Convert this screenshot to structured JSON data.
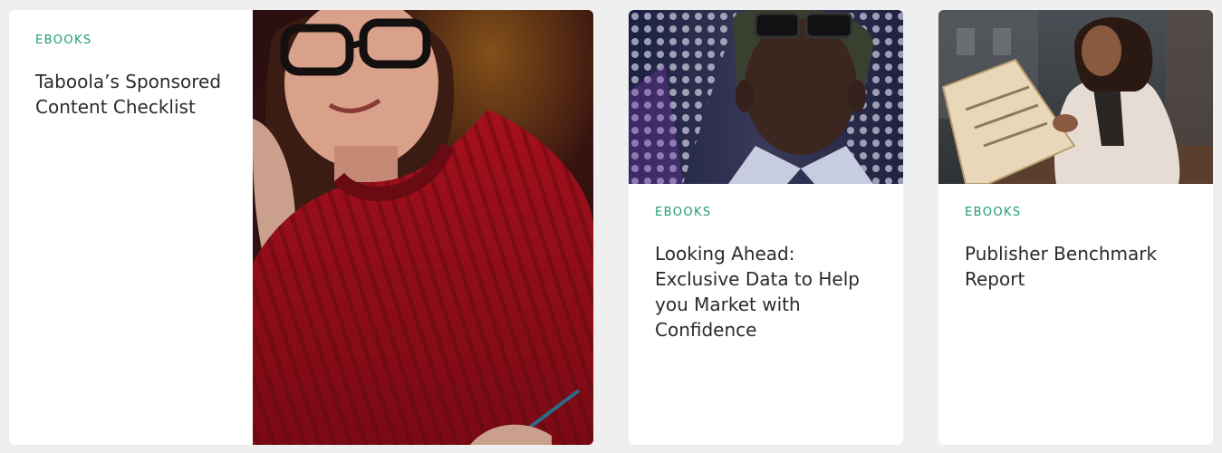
{
  "cards": [
    {
      "category": "EBOOKS",
      "title": "Taboola’s Sponsored Content Checklist",
      "image_icon": "woman-red-sweater-photo"
    },
    {
      "category": "EBOOKS",
      "title": "Looking Ahead: Exclusive Data to Help you Market with Confidence",
      "image_icon": "man-glasses-lights-photo"
    },
    {
      "category": "EBOOKS",
      "title": "Publisher Benchmark Report",
      "image_icon": "woman-reading-newspaper-photo"
    }
  ],
  "colors": {
    "accent": "#1f9e6c",
    "title": "#2b2b2b",
    "background": "#efefef",
    "card": "#ffffff"
  }
}
